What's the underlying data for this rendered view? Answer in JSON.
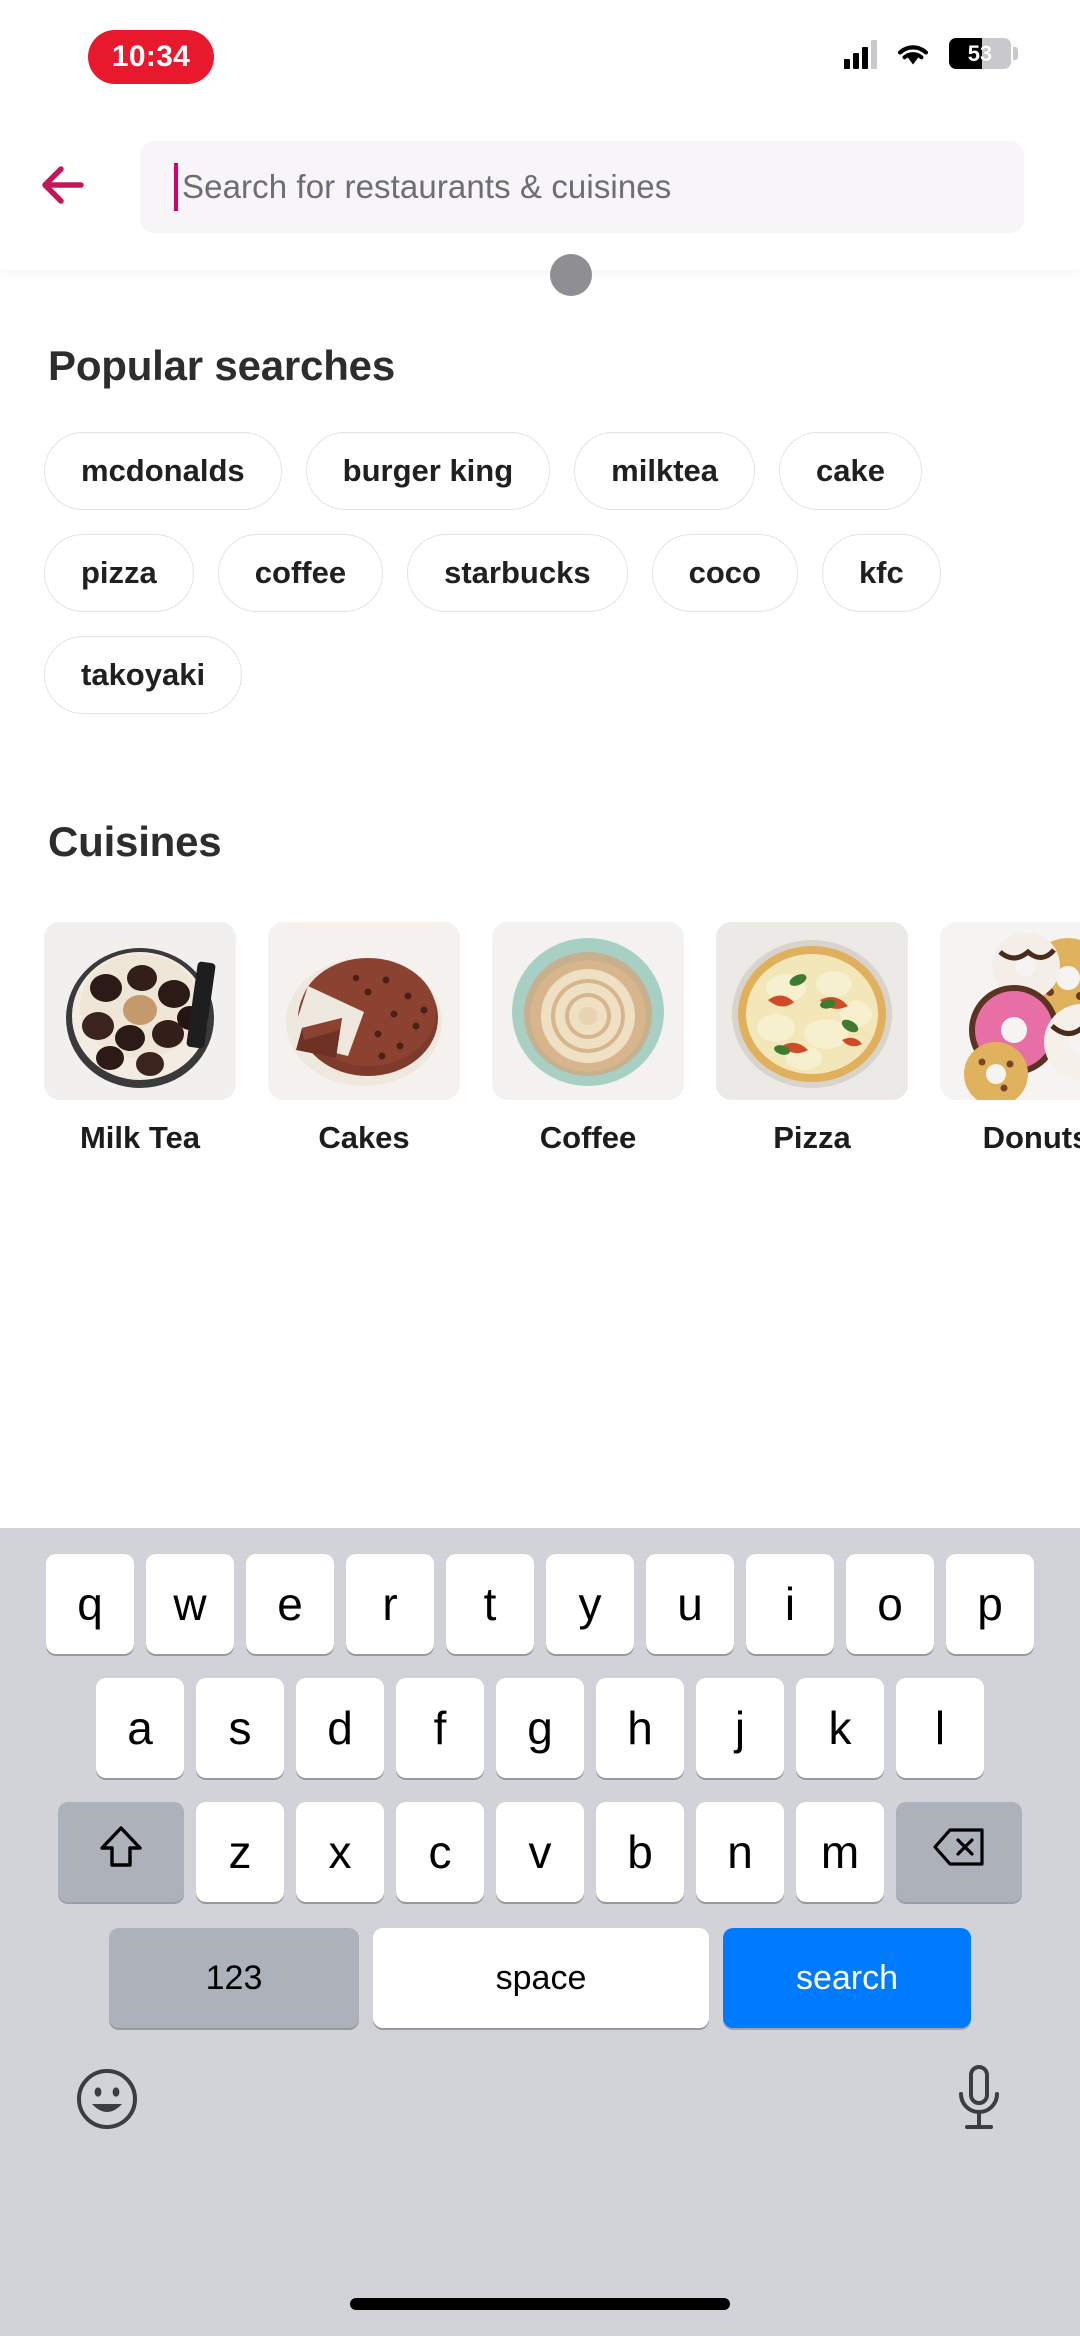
{
  "status_bar": {
    "time": "10:34",
    "battery_percent": "53",
    "icons": [
      "cellular-signal-icon",
      "wifi-icon",
      "battery-icon"
    ]
  },
  "header": {
    "back_icon": "back-arrow-icon",
    "search_placeholder": "Search for restaurants & cuisines",
    "search_value": "",
    "accent_color": "#d6006e"
  },
  "popular": {
    "title": "Popular searches",
    "chips": [
      "mcdonalds",
      "burger king",
      "milktea",
      "cake",
      "pizza",
      "coffee",
      "starbucks",
      "coco",
      "kfc",
      "takoyaki"
    ]
  },
  "cuisines": {
    "title": "Cuisines",
    "items": [
      {
        "label": "Milk Tea",
        "image": "boba-milk-tea-photo"
      },
      {
        "label": "Cakes",
        "image": "chocolate-cake-photo"
      },
      {
        "label": "Coffee",
        "image": "latte-coffee-photo"
      },
      {
        "label": "Pizza",
        "image": "pizza-photo"
      },
      {
        "label": "Donuts",
        "image": "donuts-photo"
      }
    ]
  },
  "keyboard": {
    "row1": [
      "q",
      "w",
      "e",
      "r",
      "t",
      "y",
      "u",
      "i",
      "o",
      "p"
    ],
    "row2": [
      "a",
      "s",
      "d",
      "f",
      "g",
      "h",
      "j",
      "k",
      "l"
    ],
    "row3": [
      "z",
      "x",
      "c",
      "v",
      "b",
      "n",
      "m"
    ],
    "shift_icon": "shift-arrow-icon",
    "backspace_icon": "backspace-delete-icon",
    "numbers_label": "123",
    "space_label": "space",
    "search_label": "search",
    "emoji_icon": "emoji-smiley-icon",
    "mic_icon": "microphone-icon",
    "search_key_color": "#007aff"
  }
}
